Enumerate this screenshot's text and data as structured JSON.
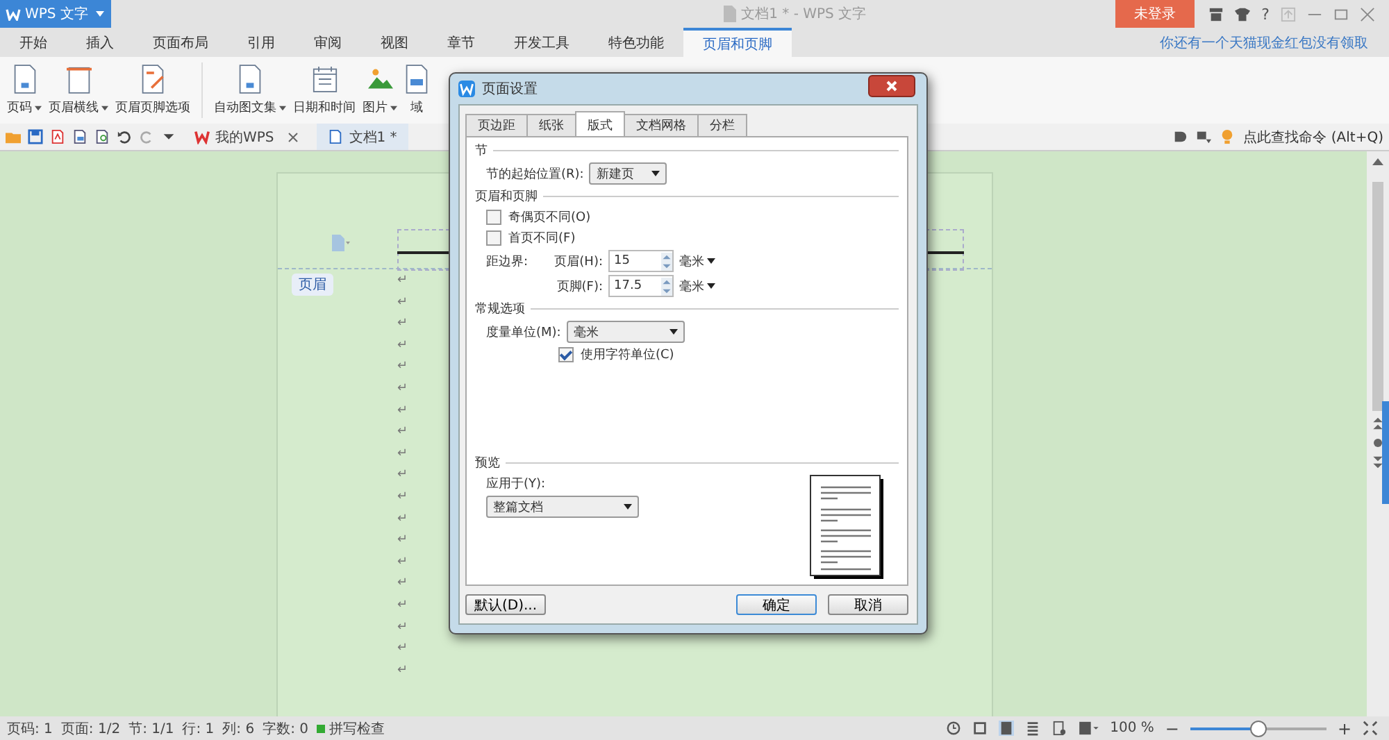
{
  "app": {
    "logo": "WPS 文字",
    "title": "文档1 * - WPS 文字",
    "login": "未登录",
    "help": "?",
    "promo": "你还有一个天猫现金红包没有领取"
  },
  "tabs": [
    {
      "label": "开始",
      "selected": false
    },
    {
      "label": "插入",
      "selected": false
    },
    {
      "label": "页面布局",
      "selected": false
    },
    {
      "label": "引用",
      "selected": false
    },
    {
      "label": "审阅",
      "selected": false
    },
    {
      "label": "视图",
      "selected": false
    },
    {
      "label": "章节",
      "selected": false
    },
    {
      "label": "开发工具",
      "selected": false
    },
    {
      "label": "特色功能",
      "selected": false
    },
    {
      "label": "页眉和页脚",
      "selected": true
    }
  ],
  "ribbon": [
    {
      "label": "页码",
      "kind": "page",
      "dropdown": true
    },
    {
      "label": "页眉横线",
      "kind": "line",
      "dropdown": true
    },
    {
      "label": "页眉页脚选项",
      "kind": "options",
      "dropdown": false
    },
    {
      "label": "自动图文集",
      "kind": "page",
      "dropdown": true
    },
    {
      "label": "日期和时间",
      "kind": "calendar",
      "dropdown": false
    },
    {
      "label": "图片",
      "kind": "image",
      "dropdown": true
    },
    {
      "label": "域",
      "kind": "field",
      "dropdown": false
    }
  ],
  "doc_tabs": [
    {
      "label": "我的WPS",
      "kind": "wps",
      "selected": false
    },
    {
      "label": "文档1 *",
      "kind": "doc",
      "selected": true
    }
  ],
  "search_command": "点此查找命令 (Alt+Q)",
  "document": {
    "header_label": "页眉",
    "paragraph_marks": [
      "↵",
      "↵",
      "↵",
      "↵",
      "↵",
      "↵",
      "↵",
      "↵",
      "↵",
      "↵",
      "↵",
      "↵",
      "↵",
      "↵",
      "↵",
      "↵",
      "↵",
      "↵",
      "↵"
    ]
  },
  "dialog": {
    "title": "页面设置",
    "tabs": [
      {
        "label": "页边距",
        "selected": false
      },
      {
        "label": "纸张",
        "selected": false
      },
      {
        "label": "版式",
        "selected": true
      },
      {
        "label": "文档网格",
        "selected": false
      },
      {
        "label": "分栏",
        "selected": false
      }
    ],
    "section": {
      "heading": "节",
      "start_label": "节的起始位置(R):",
      "start_value": "新建页"
    },
    "header_footer": {
      "heading": "页眉和页脚",
      "checkboxes": [
        {
          "label": "奇偶页不同(O)",
          "checked": false
        },
        {
          "label": "首页不同(F)",
          "checked": false
        }
      ],
      "distance_label": "距边界:",
      "fields": [
        {
          "label": "页眉(H):",
          "value": "15",
          "unit": "毫米"
        },
        {
          "label": "页脚(F):",
          "value": "17.5",
          "unit": "毫米"
        }
      ]
    },
    "general": {
      "heading": "常规选项",
      "unit_label": "度量单位(M):",
      "unit_value": "毫米",
      "char_unit": {
        "label": "使用字符单位(C)",
        "checked": true
      }
    },
    "preview": {
      "heading": "预览",
      "apply_label": "应用于(Y):",
      "apply_value": "整篇文档"
    },
    "buttons": {
      "default": "默认(D)...",
      "ok": "确定",
      "cancel": "取消"
    }
  },
  "status": [
    {
      "label": "页码: 1"
    },
    {
      "label": "页面: 1/2"
    },
    {
      "label": "节: 1/1"
    },
    {
      "label": "行: 1"
    },
    {
      "label": "列: 6"
    },
    {
      "label": "字数: 0"
    }
  ],
  "spell_check": "拼写检查",
  "zoom": {
    "value": "100 %",
    "minus": "−",
    "plus": "+",
    "level": 0.5
  }
}
